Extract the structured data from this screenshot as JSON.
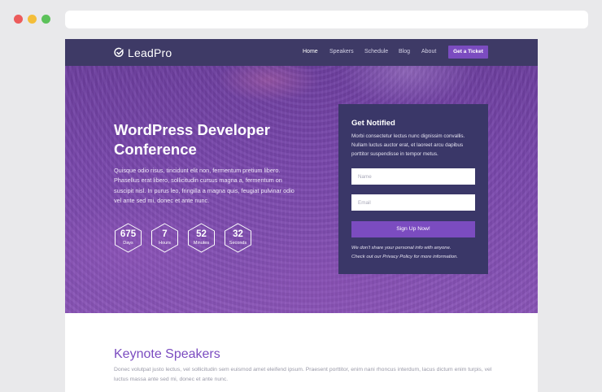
{
  "brand": {
    "name": "LeadPro",
    "accent": "#7b4cc0",
    "nav_bg": "#3e3a66"
  },
  "nav": {
    "items": [
      {
        "label": "Home",
        "active": true
      },
      {
        "label": "Speakers",
        "active": false
      },
      {
        "label": "Schedule",
        "active": false
      },
      {
        "label": "Blog",
        "active": false
      },
      {
        "label": "About",
        "active": false
      }
    ],
    "cta_label": "Get a Ticket"
  },
  "hero": {
    "title_line1": "WordPress Developer",
    "title_line2": "Conference",
    "description": "Quisque odio risus, tincidunt elit non, fermentum pretium libero. Phasellus erat libero, sollicitudin cursus magna a, fermentum on suscipit nisl. In purus leo, fringilla a magna quis, feugiat pulvinar odio vel ante sed mi, donec et ante nunc."
  },
  "countdown": [
    {
      "value": "675",
      "label": "Days"
    },
    {
      "value": "7",
      "label": "Hours"
    },
    {
      "value": "52",
      "label": "Minutes"
    },
    {
      "value": "32",
      "label": "Seconds"
    }
  ],
  "notify": {
    "title": "Get Notified",
    "description": "Morbi consectetur lectus nunc dignissim convallis. Nullam luctus auctor erat, et laoreet arcu dapibus porttitor suspendisse in tempor metus.",
    "name_placeholder": "Name",
    "email_placeholder": "Email",
    "submit_label": "Sign Up Now!",
    "note_line1": "We don't share your personal info with anyone.",
    "note_line2": "Check out our Privacy Policy for more information."
  },
  "speakers": {
    "title": "Keynote Speakers",
    "description": "Donec volutpat justo lectus, vel sollicitudin sem euismod amet eleifend ipsum. Praesent porttitor, enim nani rhoncus interdum, lacus dictum enim turpis, vel luctus massa ante sed mi, donec et ante nunc."
  }
}
